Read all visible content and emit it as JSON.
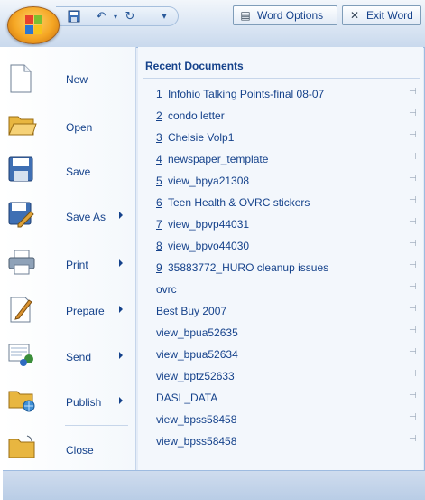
{
  "commands": [
    {
      "label": "New",
      "accel": "N"
    },
    {
      "label": "Open",
      "accel": "O"
    },
    {
      "label": "Save",
      "accel": "S"
    },
    {
      "label": "Save As",
      "accel": "A"
    },
    {
      "label": "Print",
      "accel": "P"
    },
    {
      "label": "Prepare",
      "accel": "E"
    },
    {
      "label": "Send",
      "accel": "D"
    },
    {
      "label": "Publish",
      "accel": "U"
    },
    {
      "label": "Close",
      "accel": "C"
    }
  ],
  "recent": {
    "title": "Recent Documents",
    "items": [
      {
        "num": "1",
        "name": "Infohio Talking Points-final 08-07"
      },
      {
        "num": "2",
        "name": "condo letter"
      },
      {
        "num": "3",
        "name": "Chelsie Volp1"
      },
      {
        "num": "4",
        "name": "newspaper_template"
      },
      {
        "num": "5",
        "name": "view_bpya21308"
      },
      {
        "num": "6",
        "name": "Teen Health & OVRC stickers"
      },
      {
        "num": "7",
        "name": "view_bpvp44031"
      },
      {
        "num": "8",
        "name": "view_bpvo44030"
      },
      {
        "num": "9",
        "name": "35883772_HURO cleanup issues"
      },
      {
        "num": "",
        "name": "ovrc"
      },
      {
        "num": "",
        "name": "Best Buy 2007"
      },
      {
        "num": "",
        "name": "view_bpua52635"
      },
      {
        "num": "",
        "name": "view_bpua52634"
      },
      {
        "num": "",
        "name": "view_bptz52633"
      },
      {
        "num": "",
        "name": "DASL_DATA"
      },
      {
        "num": "",
        "name": "view_bpss58458"
      },
      {
        "num": "",
        "name": "view_bpss58458"
      }
    ]
  },
  "footer": {
    "word_options": "Word Options",
    "exit_word": "Exit Word"
  },
  "icons": {
    "office_button": "office-logo-icon",
    "save": "save-icon",
    "undo": "undo-icon",
    "redo": "redo-icon",
    "customize": "customize-qat-icon"
  }
}
